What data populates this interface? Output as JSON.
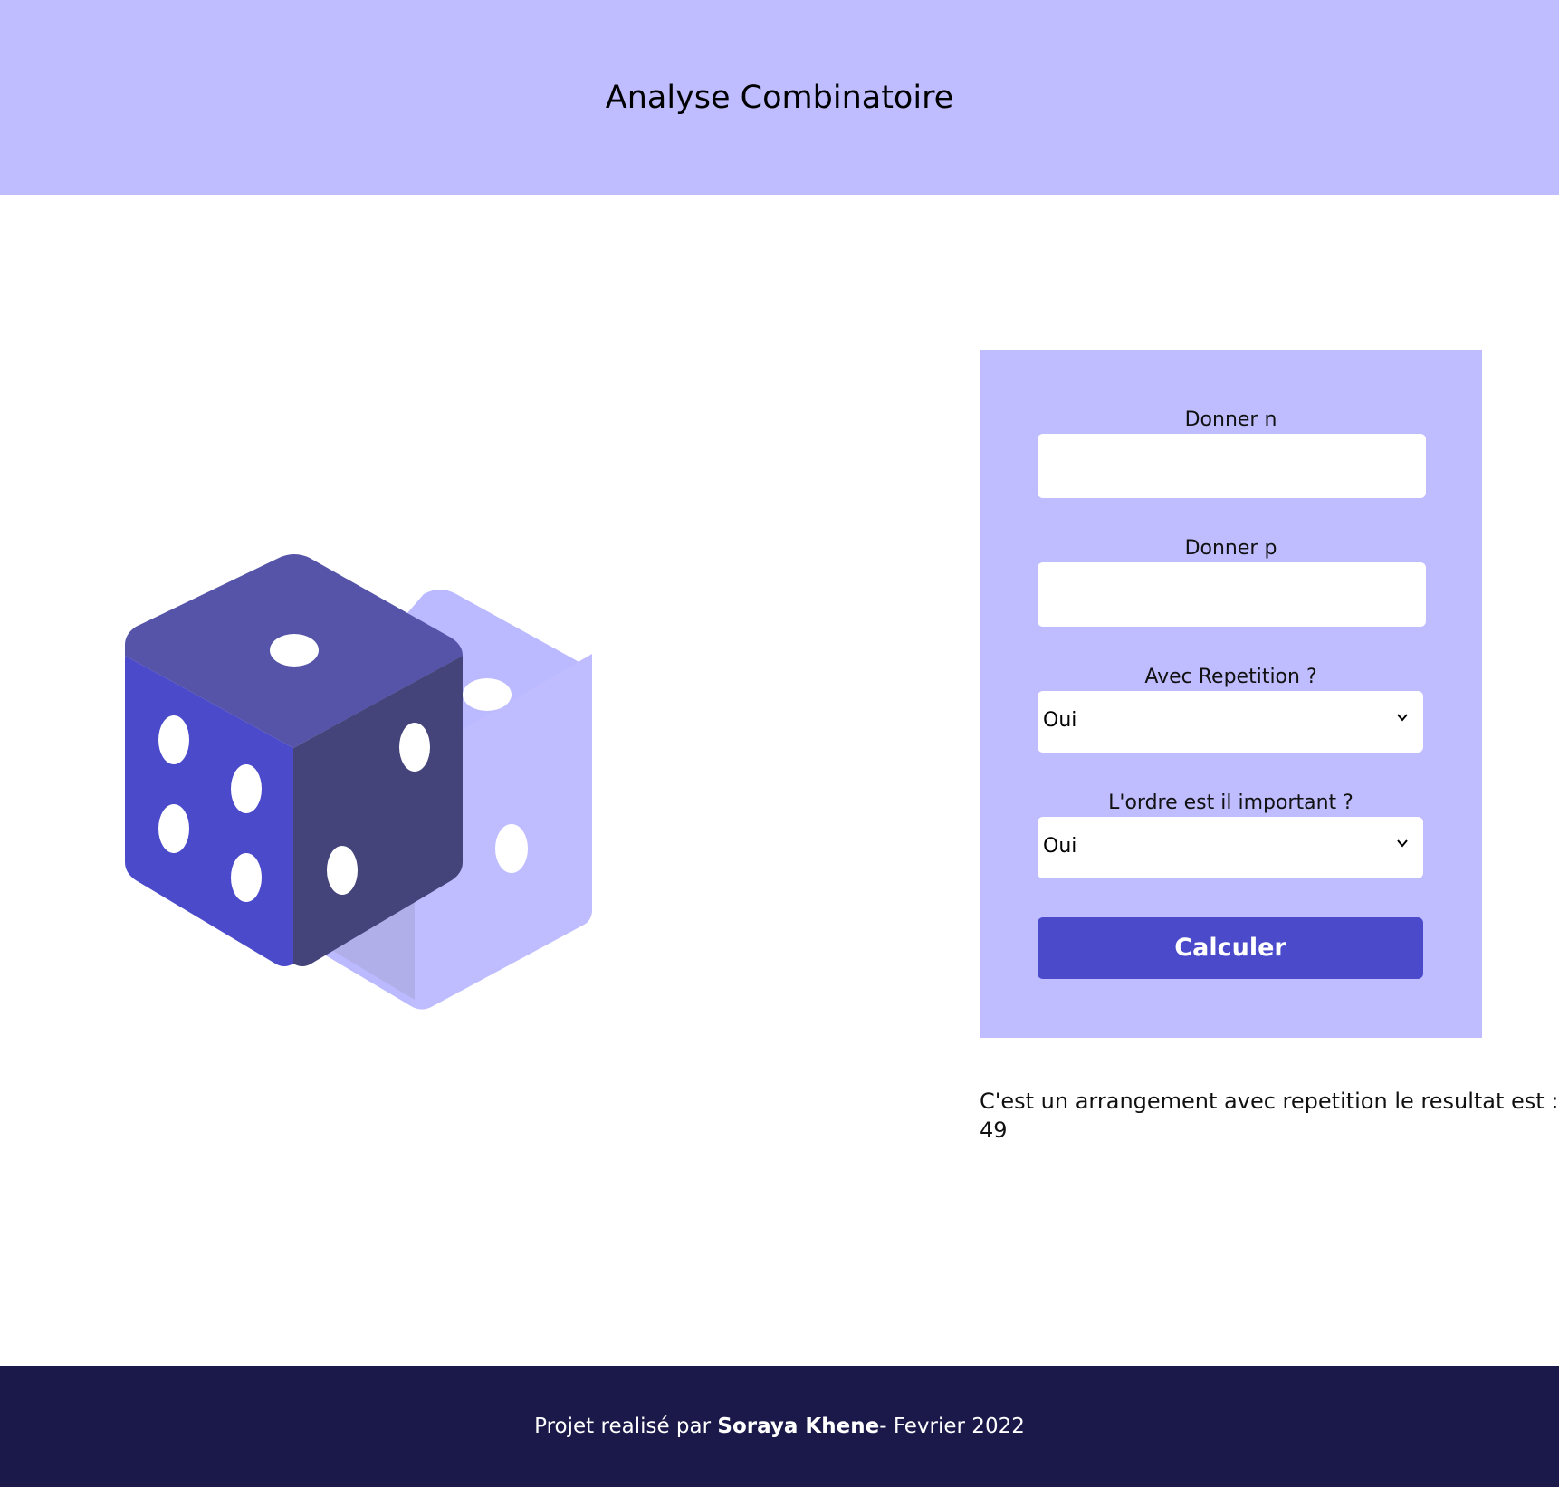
{
  "header": {
    "title": "Analyse Combinatoire"
  },
  "form": {
    "n_label": "Donner n",
    "n_value": "",
    "p_label": "Donner p",
    "p_value": "",
    "repetition_label": "Avec Repetition ?",
    "repetition_value": "Oui",
    "order_label": "L'ordre est il important ?",
    "order_value": "Oui",
    "submit_label": "Calculer"
  },
  "result": {
    "text": "C'est un arrangement avec repetition le resultat est : 49"
  },
  "footer": {
    "prefix": "Projet realisé par ",
    "author": "Soraya Khene",
    "suffix": "- Fevrier 2022"
  },
  "colors": {
    "header_bg": "#bfbdff",
    "card_bg": "#bfbdff",
    "button_bg": "#4b4acb",
    "footer_bg": "#1a194a",
    "dice_top": "#5554a8",
    "dice_left": "#4b4acb",
    "dice_right": "#44447a",
    "dice_back": "#bfbdff"
  },
  "icons": [
    "dice-illustration",
    "chevron-down-icon"
  ]
}
